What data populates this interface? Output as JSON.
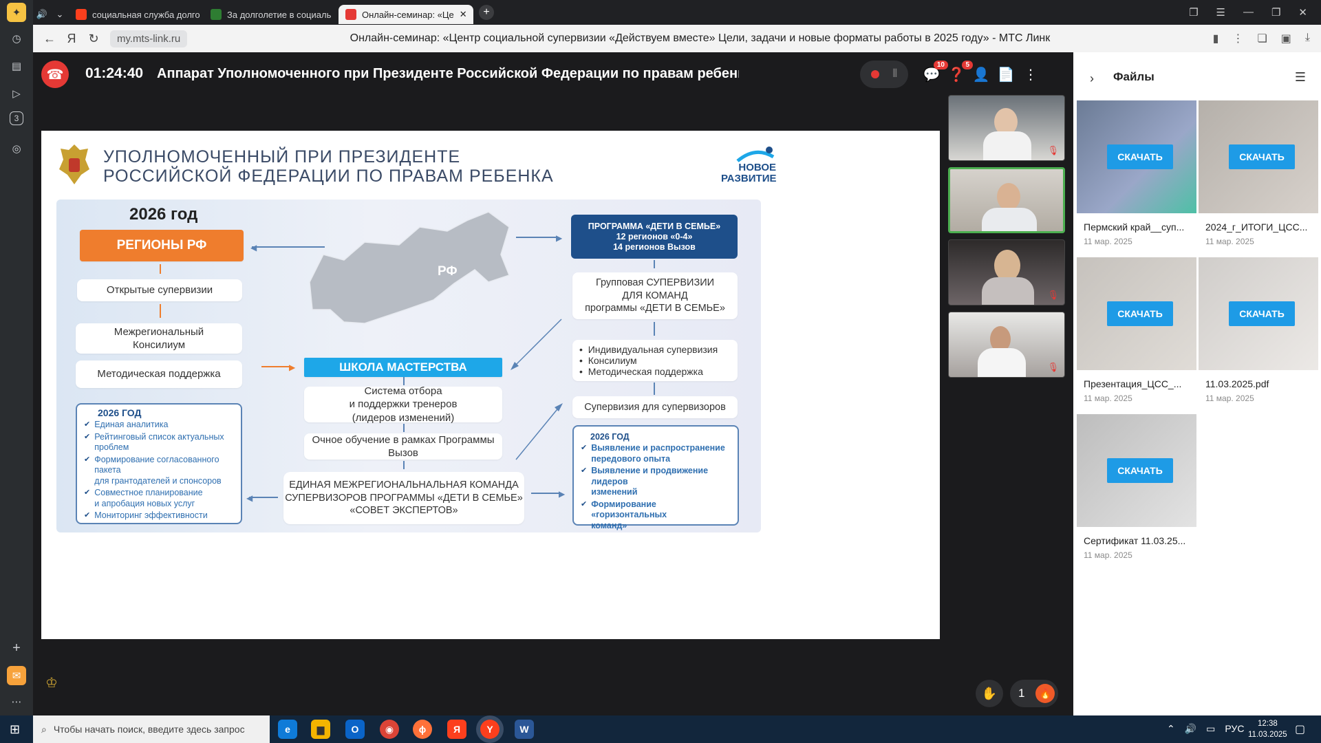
{
  "browser": {
    "tabs": [
      {
        "title": "социальная служба долго",
        "icon_color": "#fc3f1d"
      },
      {
        "title": "За долголетие в социаль",
        "icon_color": "#2e7d32"
      },
      {
        "title": "Онлайн-семинар: «Це",
        "icon_color": "#e53935"
      }
    ],
    "url": "my.mts-link.ru",
    "page_title": "Онлайн-семинар: «Центр социальной супервизии «Действуем вместе» Цели, задачи и новые форматы работы в 2025 году» - МТС Линк"
  },
  "rail": {
    "badge": "3"
  },
  "webinar": {
    "timer": "01:24:40",
    "title": "Аппарат Уполномоченного при Президенте Российской Федерации по правам ребенка    Онлайн-семи",
    "chat_badge": "10",
    "questions_badge": "5",
    "hands_count": "1"
  },
  "slide": {
    "header_line1": "УПОЛНОМОЧЕННЫЙ ПРИ ПРЕЗИДЕНТЕ",
    "header_line2": "РОССИЙСКОЙ ФЕДЕРАЦИИ ПО ПРАВАМ РЕБЕНКА",
    "logo_line1": "НОВОЕ",
    "logo_line2": "РАЗВИТИЕ",
    "year_title": "2026 год",
    "regions": "РЕГИОНЫ РФ",
    "open_supervisions": "Открытые супервизии",
    "consilium_l1": "Межрегиональный",
    "consilium_l2": "Консилиум",
    "method_support": "Методическая поддержка",
    "left_box_title": "2026 ГОД",
    "left_box_items": [
      "Единая аналитика",
      "Рейтинговый список актуальных\nпроблем",
      "Формирование согласованного\nпакета\nдля грантодателей и спонсоров",
      "Совместное планирование\nи апробация новых услуг",
      "Мониторинг эффективности"
    ],
    "map_label": "РФ",
    "school": "ШКОЛА МАСТЕРСТВА",
    "trainers_l1": "Система отбора",
    "trainers_l2": "и поддержки тренеров",
    "trainers_l3": "(лидеров изменений)",
    "training_l1": "Очное обучение в рамках Программы",
    "training_l2": "Вызов",
    "team_l1": "ЕДИНАЯ МЕЖРЕГИОНАЛЬНАЛЬНАЯ КОМАНДА",
    "team_l2": "СУПЕРВИЗОРОВ ПРОГРАММЫ «ДЕТИ В СЕМЬЕ»",
    "team_l3": "«СОВЕТ ЭКСПЕРТОВ»",
    "program_l1": "ПРОГРАММА «ДЕТИ В СЕМЬЕ»",
    "program_l2": "12 регионов «0-4»",
    "program_l3": "14 регионов Вызов",
    "group_l1": "Групповая СУПЕРВИЗИИ",
    "group_l2": "ДЛЯ КОМАНД",
    "group_l3": "программы «ДЕТИ В СЕМЬЕ»",
    "bullets": [
      "Индивидуальная  супервизия",
      "Консилиум",
      "Методическая поддержка"
    ],
    "super_for_super": "Супервизия для супервизоров",
    "right_box_title": "2026 ГОД",
    "right_box_items": [
      "Выявление и распространение\nпередового опыта",
      "Выявление и продвижение лидеров\nизменений",
      "Формирование «горизонтальных\nкоманд»"
    ]
  },
  "files_panel": {
    "title": "Файлы",
    "download_label": "СКАЧАТЬ",
    "files": [
      {
        "name": "Пермский край__суп...",
        "date": "11 мар. 2025"
      },
      {
        "name": "2024_г_ИТОГИ_ЦСС...",
        "date": "11 мар. 2025"
      },
      {
        "name": "Презентация_ЦСС_...",
        "date": "11 мар. 2025"
      },
      {
        "name": "11.03.2025.pdf",
        "date": "11 мар. 2025"
      },
      {
        "name": "Сертификат 11.03.25...",
        "date": "11 мар. 2025"
      }
    ]
  },
  "taskbar": {
    "search_placeholder": "Чтобы начать поиск, введите здесь запрос",
    "lang": "РУС",
    "time": "12:38",
    "date": "11.03.2025"
  },
  "colors": {
    "accent_orange": "#ef7d2d",
    "school_blue": "#1ea7e8",
    "program_navy": "#1e4f8a",
    "end_call_red": "#e53935",
    "download_blue": "#1e9be6"
  }
}
